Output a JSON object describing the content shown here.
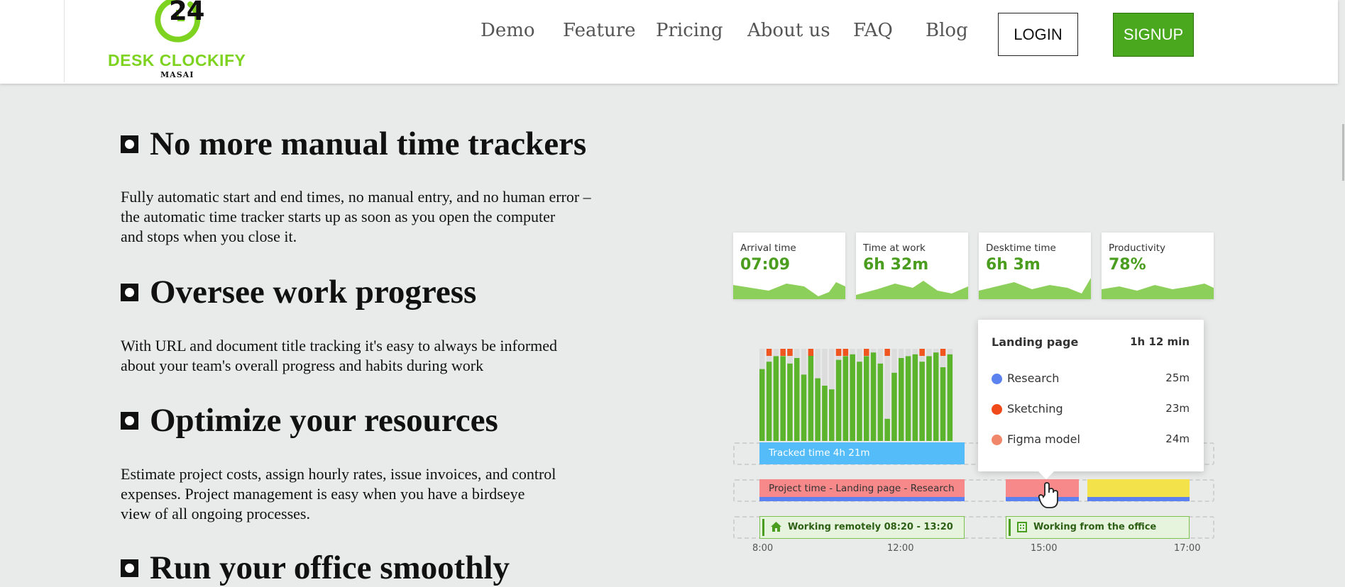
{
  "header": {
    "logo": {
      "number": "24",
      "name": "DESK CLOCKIFY",
      "sub": "MASAI"
    },
    "nav": [
      "Demo",
      "Feature",
      "Pricing",
      "About us",
      "FAQ",
      "Blog"
    ],
    "login_label": "LOGIN",
    "signup_label": "SIGNUP"
  },
  "features": [
    {
      "title": "No more manual time trackers",
      "lines": [
        "Fully automatic start and end times, no manual entry, and no human error –",
        "the automatic time tracker starts up as soon as you open the computer",
        "and stops when you close it."
      ]
    },
    {
      "title": "Oversee work progress",
      "lines": [
        "With URL and document title tracking it's easy to always be informed",
        "about your team's overall progress and habits during work"
      ]
    },
    {
      "title": "Optimize your resources",
      "lines": [
        "Estimate project costs, assign hourly rates, issue invoices, and control",
        "expenses. Project management is easy when you have a birdseye",
        "view of all ongoing processes."
      ]
    },
    {
      "title": "Run your office smoothly",
      "lines": []
    }
  ],
  "dashboard": {
    "stats": [
      {
        "label": "Arrival time",
        "value": "07:09"
      },
      {
        "label": "Time at work",
        "value": "6h 32m"
      },
      {
        "label": "Desktime time",
        "value": "6h 3m"
      },
      {
        "label": "Productivity",
        "value": "78%"
      }
    ],
    "tracked_label": "Tracked time 4h 21m",
    "project_label": "Project time - Landing page - Research",
    "remote_label": "Working remotely 08:20 - 13:20",
    "office_label": "Working from the office",
    "timeline": [
      "8:00",
      "12:00",
      "15:00",
      "17:00"
    ],
    "popup": {
      "title": "Landing page",
      "total": "1h 12 min",
      "items": [
        {
          "name": "Research",
          "duration": "25m",
          "color": "#5b82ee"
        },
        {
          "name": "Sketching",
          "duration": "23m",
          "color": "#f04a1a"
        },
        {
          "name": "Figma model",
          "duration": "24m",
          "color": "#f0866a"
        }
      ]
    },
    "colors": {
      "green": "#5bb42b",
      "blue_bar": "#54bdf9",
      "red_bar": "#f7898a",
      "yellow_bar": "#f4e24a",
      "accent": "#4a9d1e"
    }
  }
}
